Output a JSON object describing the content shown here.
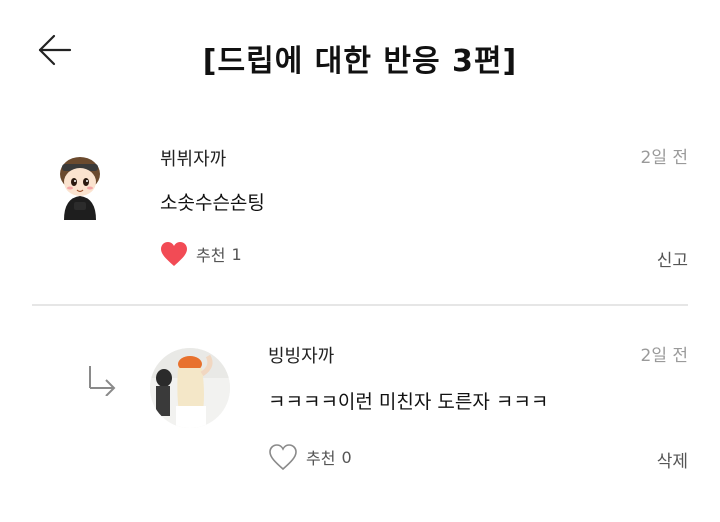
{
  "header": {
    "title": "[드립에 대한 반응 3편]"
  },
  "comments": [
    {
      "nickname": "뷔뷔자까",
      "time": "2일 전",
      "body": "소솟수슨손팅",
      "like_label": "추천",
      "like_count": "1",
      "liked": true,
      "action_label": "신고"
    },
    {
      "nickname": "빙빙자까",
      "time": "2일 전",
      "body": "ㅋㅋㅋㅋ이런 미친자 도른자 ㅋㅋㅋ",
      "like_label": "추천",
      "like_count": "0",
      "liked": false,
      "action_label": "삭제"
    }
  ],
  "colors": {
    "heart_filled": "#f24b55",
    "heart_outline": "#8a8a8a",
    "muted_text": "#9a9a9a",
    "divider": "#e6e6e6"
  },
  "icons": {
    "back": "arrow-left-icon",
    "reply": "reply-arrow-icon",
    "like_filled": "heart-filled-icon",
    "like_empty": "heart-outline-icon"
  }
}
